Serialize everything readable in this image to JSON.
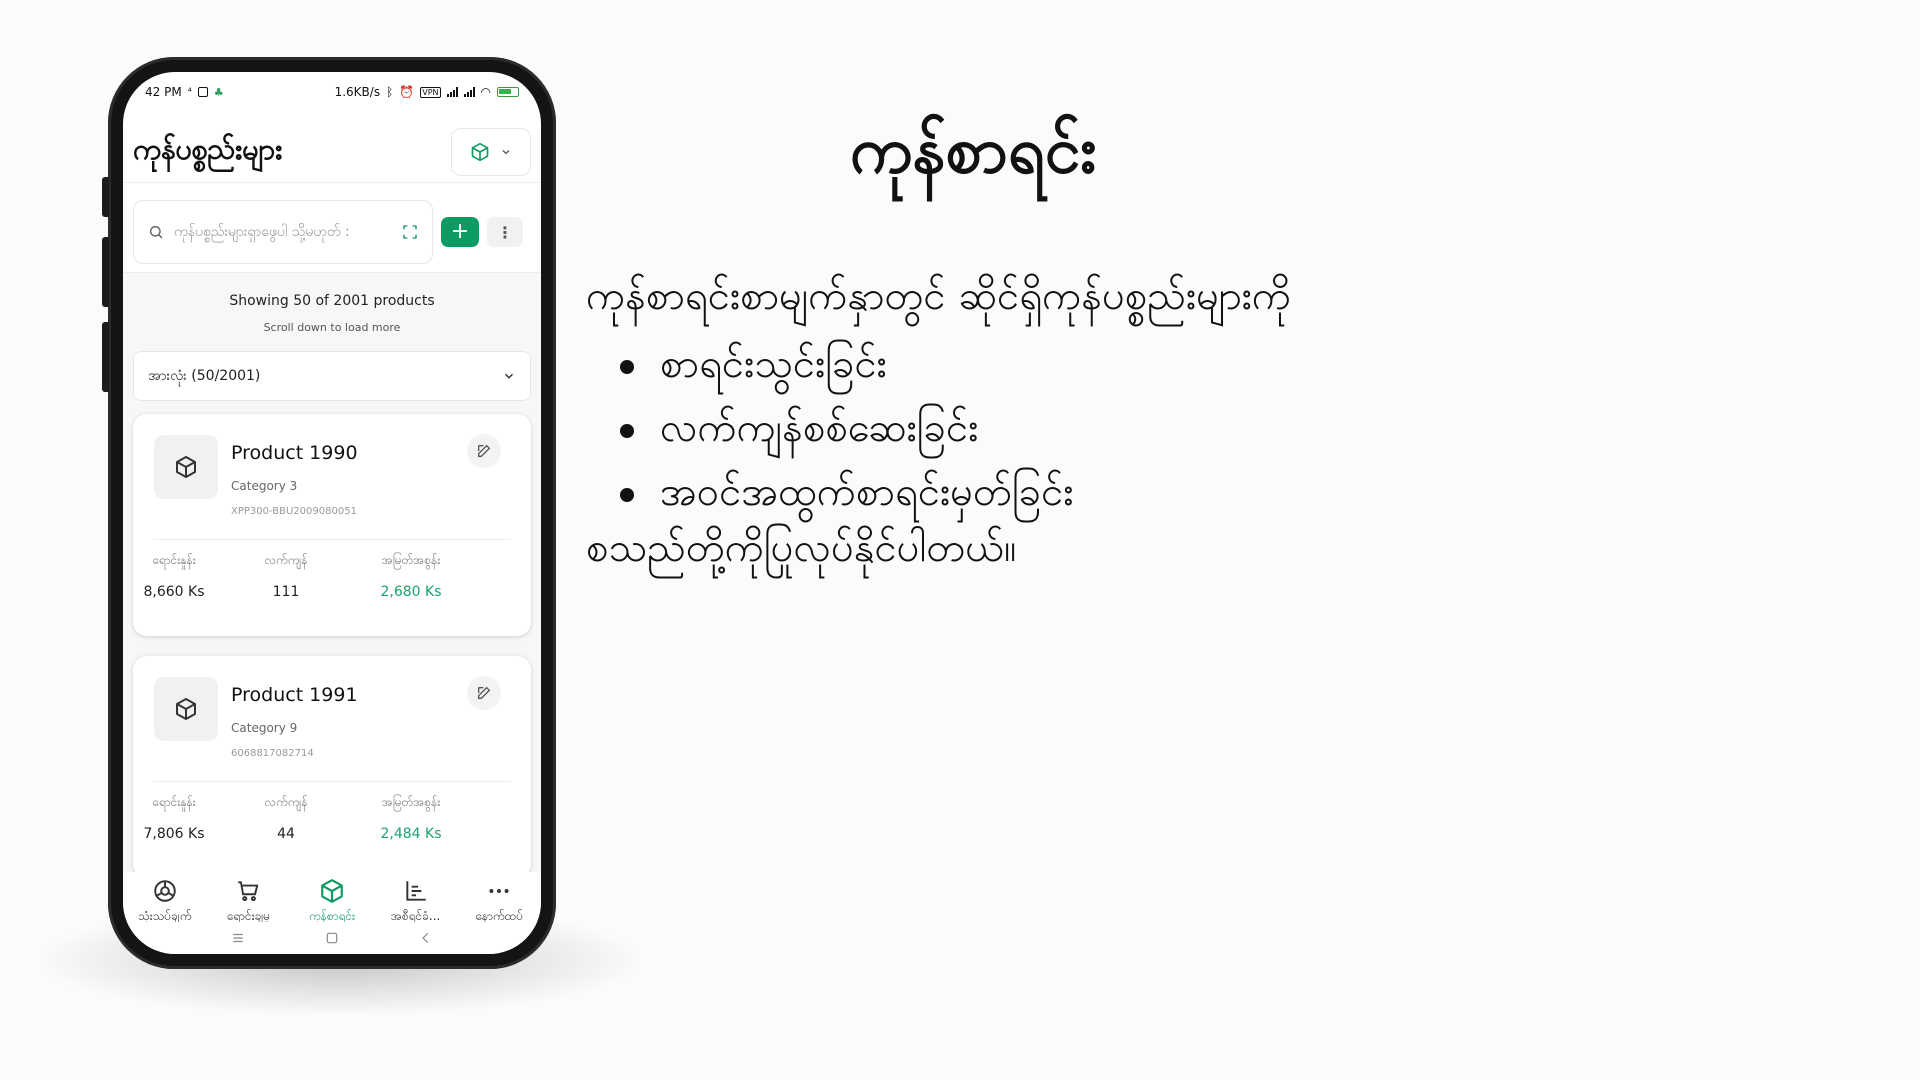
{
  "statusbar": {
    "time": "42 PM",
    "speed": "1.6KB/s",
    "vpn": "VPN",
    "battery": "84"
  },
  "header": {
    "title": "ကုန်ပစ္စည်းများ",
    "store_icon": "cube-icon",
    "accent": "#0e9a63"
  },
  "search": {
    "placeholder": "ကုန်ပစ္စည်းများရှာဖွေပါ သို့မဟုတ် :",
    "add_label": "+",
    "more_label": "⋮"
  },
  "list": {
    "showing": "Showing 50 of 2001 products",
    "scroll_hint": "Scroll down to load more",
    "filter": "အားလုံး (50/2001)"
  },
  "products": [
    {
      "name": "Product 1990",
      "category": "Category 3",
      "sku": "XPP300-BBU2009080051",
      "price_label": "ရောင်းနှုန်း",
      "price": "8,660 Ks",
      "stock_label": "လက်ကျန်",
      "stock": "111",
      "profit_label": "အမြတ်အစွန်း",
      "profit": "2,680 Ks"
    },
    {
      "name": "Product 1991",
      "category": "Category 9",
      "sku": "6068817082714",
      "price_label": "ရောင်းနှုန်း",
      "price": "7,806 Ks",
      "stock_label": "လက်ကျန်",
      "stock": "44",
      "profit_label": "အမြတ်အစွန်း",
      "profit": "2,484 Ks"
    }
  ],
  "nav": [
    {
      "label": "သုံးသပ်ချက်",
      "icon": "dashboard-icon"
    },
    {
      "label": "ရောင်းချမှု",
      "icon": "cart-icon"
    },
    {
      "label": "ကုန်စာရင်း",
      "icon": "cube-icon",
      "active": true
    },
    {
      "label": "အစီရင်ခံ...",
      "icon": "report-icon"
    },
    {
      "label": "နောက်ထပ်",
      "icon": "more-icon"
    }
  ],
  "slide": {
    "heading": "ကုန်စာရင်း",
    "intro": "ကုန်စာရင်းစာမျက်နှာတွင် ဆိုင်ရှိကုန်ပစ္စည်းများကို",
    "bullets": [
      "စာရင်းသွင်းခြင်း",
      "လက်ကျန်စစ်ဆေးခြင်း",
      "အဝင်အထွက်စာရင်းမှတ်ခြင်း"
    ],
    "outro": "စသည်တို့ကိုပြုလုပ်နိုင်ပါတယ်။"
  }
}
